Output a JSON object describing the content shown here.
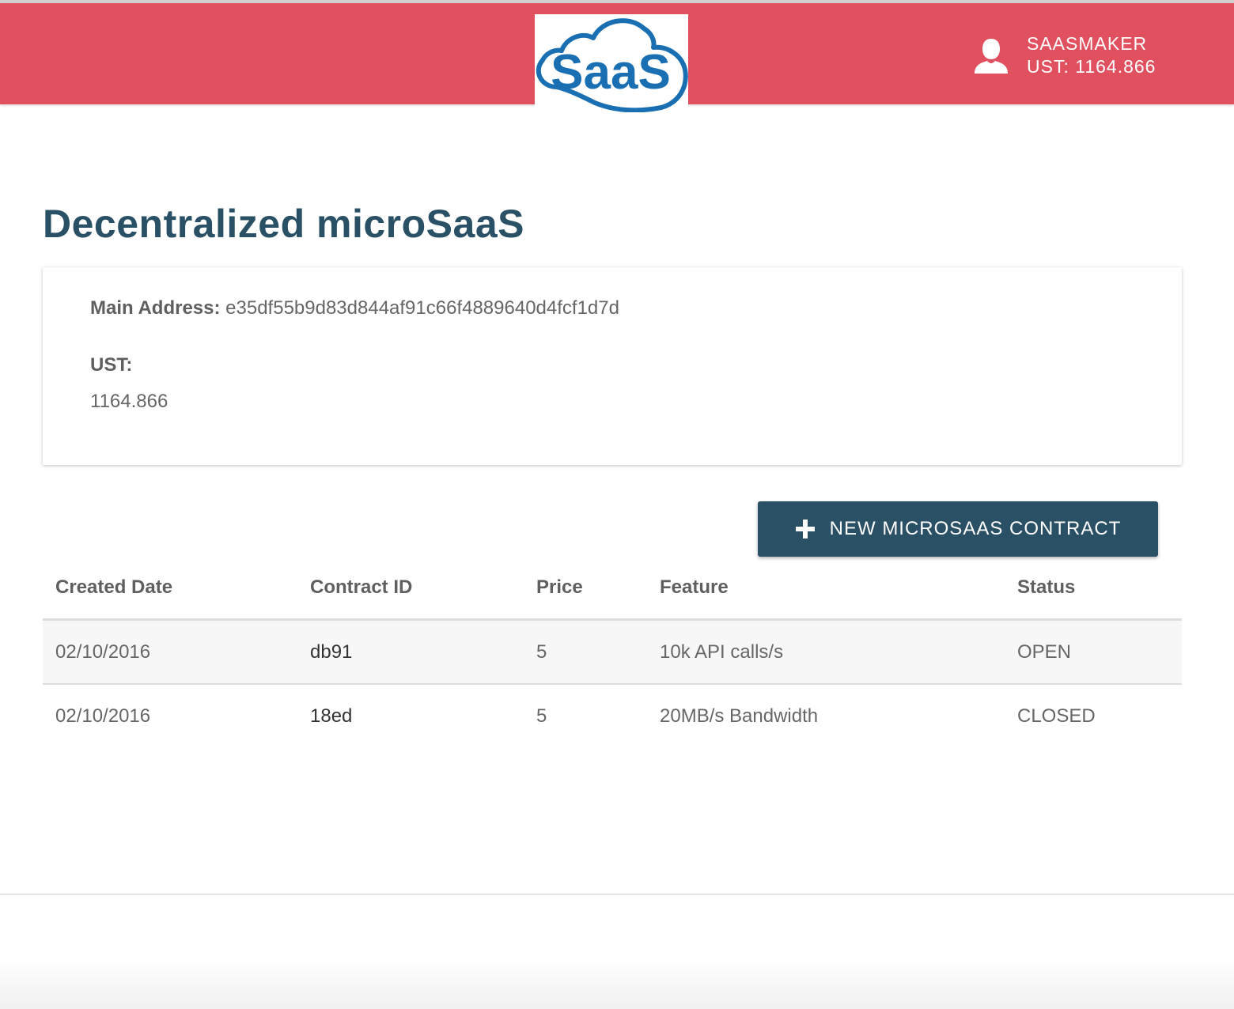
{
  "header": {
    "logo_text": "SaaS",
    "username": "SAASMAKER",
    "balance": "UST: 1164.866",
    "colors": {
      "background": "#e0505f",
      "logo": "#1a6fb3"
    }
  },
  "page": {
    "title": "Decentralized microSaaS"
  },
  "account_card": {
    "address_label": "Main Address:",
    "address_value": "e35df55b9d83d844af91c66f4889640d4fcf1d7d",
    "ust_label": "UST:",
    "ust_value": "1164.866"
  },
  "actions": {
    "new_contract_label": "NEW MICROSAAS CONTRACT",
    "new_contract_icon": "plus-icon",
    "button_color": "#2a5066"
  },
  "table": {
    "headers": [
      "Created Date",
      "Contract ID",
      "Price",
      "Feature",
      "Status"
    ],
    "rows": [
      {
        "date": "02/10/2016",
        "id": "db91",
        "price": "5",
        "feature": "10k API calls/s",
        "status": "OPEN"
      },
      {
        "date": "02/10/2016",
        "id": "18ed",
        "price": "5",
        "feature": "20MB/s Bandwidth",
        "status": "CLOSED"
      }
    ]
  }
}
